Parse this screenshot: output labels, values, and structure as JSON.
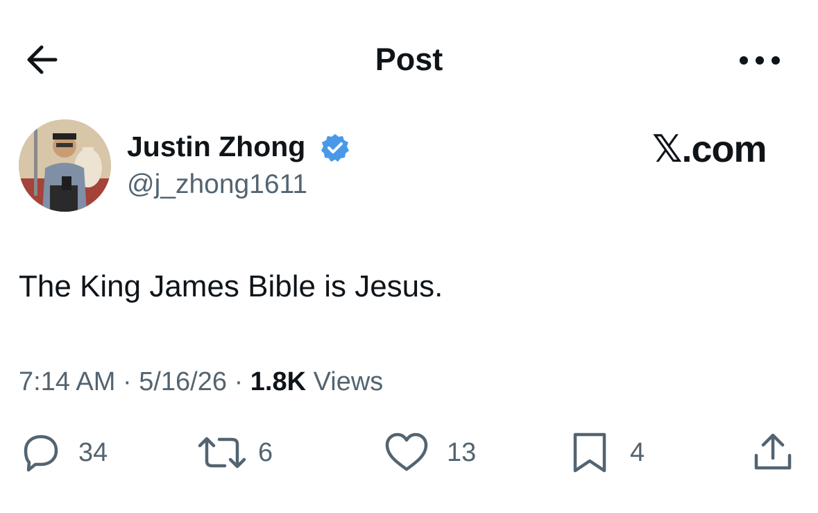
{
  "header": {
    "title": "Post",
    "back_icon": "arrow-left-icon",
    "more_icon": "more-dots-icon"
  },
  "author": {
    "display_name": "Justin Zhong",
    "handle": "@j_zhong1611",
    "verified": true,
    "verified_color": "#4a99e9"
  },
  "brand": {
    "text": ".com",
    "logo_icon": "x-logo-icon"
  },
  "post": {
    "text": "The King James Bible is Jesus.",
    "time": "7:14 AM",
    "separator": "·",
    "date": "5/16/26",
    "views_count": "1.8K",
    "views_label": "Views"
  },
  "actions": {
    "replies": {
      "icon": "reply-icon",
      "count": "34"
    },
    "reposts": {
      "icon": "repost-icon",
      "count": "6"
    },
    "likes": {
      "icon": "like-icon",
      "count": "13"
    },
    "bookmarks": {
      "icon": "bookmark-icon",
      "count": "4"
    },
    "share": {
      "icon": "share-icon"
    }
  },
  "colors": {
    "text": "#0f1419",
    "secondary": "#536471",
    "accent": "#1d9bf0"
  }
}
